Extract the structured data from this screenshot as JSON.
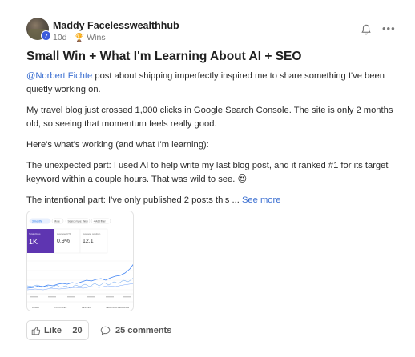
{
  "post": {
    "author": "Maddy Facelesswealthhub",
    "level": "7",
    "time": "10d",
    "separator": "·",
    "category": "Wins",
    "title": "Small Win + What I'm Learning About AI + SEO",
    "mention": "@Norbert Fichte",
    "paragraph1_rest": " post about shipping imperfectly inspired me to share something I've been quietly working on.",
    "paragraph2": "My travel blog just crossed 1,000 clicks in Google Search Console. The site is only 2 months old, so seeing that momentum feels really good.",
    "paragraph3": "Here's what's working (and what I'm learning):",
    "paragraph4": "The unexpected part: I used AI to help write my last blog post, and it ranked #1 for its target keyword within a couple hours. That was wild to see. 😍",
    "paragraph5": "The intentional part: I've only published 2 posts this ... ",
    "see_more": "See more"
  },
  "actions": {
    "like_label": "Like",
    "like_count": "20",
    "comments_label": "25 comments"
  },
  "icons": {
    "bell": "bell-icon",
    "more": "more-icon",
    "like": "thumbs-up-icon",
    "comment": "comment-icon",
    "trophy": "trophy-icon"
  },
  "thumbnail": {
    "filter_chip_1": "3 months",
    "filter_chip_2": "More",
    "filter_chip_3": "Search type: Web",
    "filter_chip_4": "+ Add filter",
    "metric_1_label": "Total clicks",
    "metric_1_value": "1K",
    "metric_2_label": "Average CTR",
    "metric_2_value": "0.9%",
    "metric_3_label": "Average position",
    "metric_3_value": "12.1",
    "tab_1": "PAGES",
    "tab_2": "COUNTRIES",
    "tab_3": "DEVICES",
    "tab_4": "SEARCH APPEARANCE",
    "colors": {
      "clicks": "#4285f4",
      "ctr": "#1a73e8",
      "position": "#e37400",
      "card_active": "#5e35b1"
    }
  },
  "colors": {
    "link": "#3b6fd1",
    "level_badge": "#3b5bdb"
  }
}
